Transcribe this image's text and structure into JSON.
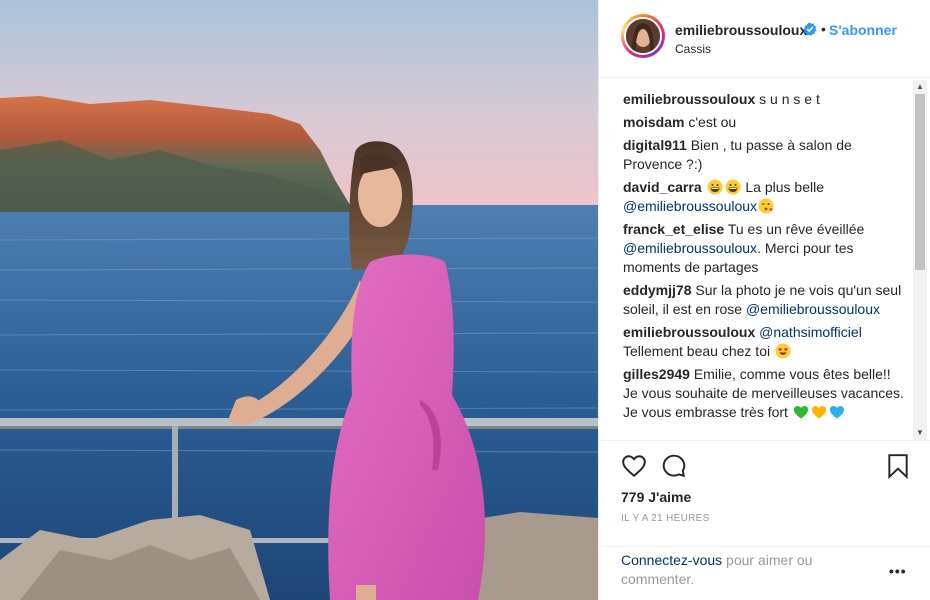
{
  "post": {
    "username": "emiliebroussouloux",
    "follow_label": "S'abonner",
    "location": "Cassis",
    "separator": "•"
  },
  "comments": [
    {
      "user": "emiliebroussouloux",
      "parts": [
        {
          "type": "text",
          "value": "s u n s e t"
        }
      ]
    },
    {
      "user": "moisdam",
      "parts": [
        {
          "type": "text",
          "value": "c'est ou"
        }
      ]
    },
    {
      "user": "digital911",
      "parts": [
        {
          "type": "text",
          "value": "Bien , tu passe à salon de Provence ?:)"
        }
      ]
    },
    {
      "user": "david_carra",
      "parts": [
        {
          "type": "emoji",
          "name": "grinning-face"
        },
        {
          "type": "emoji",
          "name": "grinning-face"
        },
        {
          "type": "text",
          "value": " La plus belle "
        },
        {
          "type": "mention",
          "value": "@emiliebroussouloux"
        },
        {
          "type": "emoji",
          "name": "kissing-face"
        }
      ]
    },
    {
      "user": "franck_et_elise",
      "parts": [
        {
          "type": "text",
          "value": "Tu es un rêve éveillée "
        },
        {
          "type": "mention",
          "value": "@emiliebroussouloux"
        },
        {
          "type": "text",
          "value": ". Merci pour tes moments de partages"
        }
      ]
    },
    {
      "user": "eddymjj78",
      "parts": [
        {
          "type": "text",
          "value": "Sur la photo je ne vois qu'un seul soleil, il est en rose "
        },
        {
          "type": "mention",
          "value": "@emiliebroussouloux"
        }
      ]
    },
    {
      "user": "emiliebroussouloux",
      "parts": [
        {
          "type": "mention",
          "value": "@nathsimofficiel"
        },
        {
          "type": "text",
          "value": " Tellement beau chez toi "
        },
        {
          "type": "emoji",
          "name": "heart-eyes-face"
        }
      ]
    },
    {
      "user": "gilles2949",
      "parts": [
        {
          "type": "text",
          "value": "Emilie, comme vous êtes belle!! Je vous souhaite de merveilleuses vacances. Je vous embrasse très fort "
        },
        {
          "type": "emoji",
          "name": "green-heart"
        },
        {
          "type": "emoji",
          "name": "yellow-heart"
        },
        {
          "type": "emoji",
          "name": "blue-heart"
        }
      ]
    }
  ],
  "actions": {
    "icons": [
      "heart-icon",
      "comment-icon",
      "bookmark-icon"
    ],
    "likes": "779 J'aime",
    "timestamp": "IL Y A 21 HEURES"
  },
  "footer": {
    "login_link": "Connectez-vous",
    "login_text": " pour aimer ou commenter.",
    "more_label": "•••"
  },
  "colors": {
    "link": "#3897f0",
    "mention": "#003569",
    "muted": "#999999",
    "verified": "#3897f0"
  },
  "scrollbar": {
    "position_fraction": 0.0,
    "visible_fraction": 0.5
  }
}
